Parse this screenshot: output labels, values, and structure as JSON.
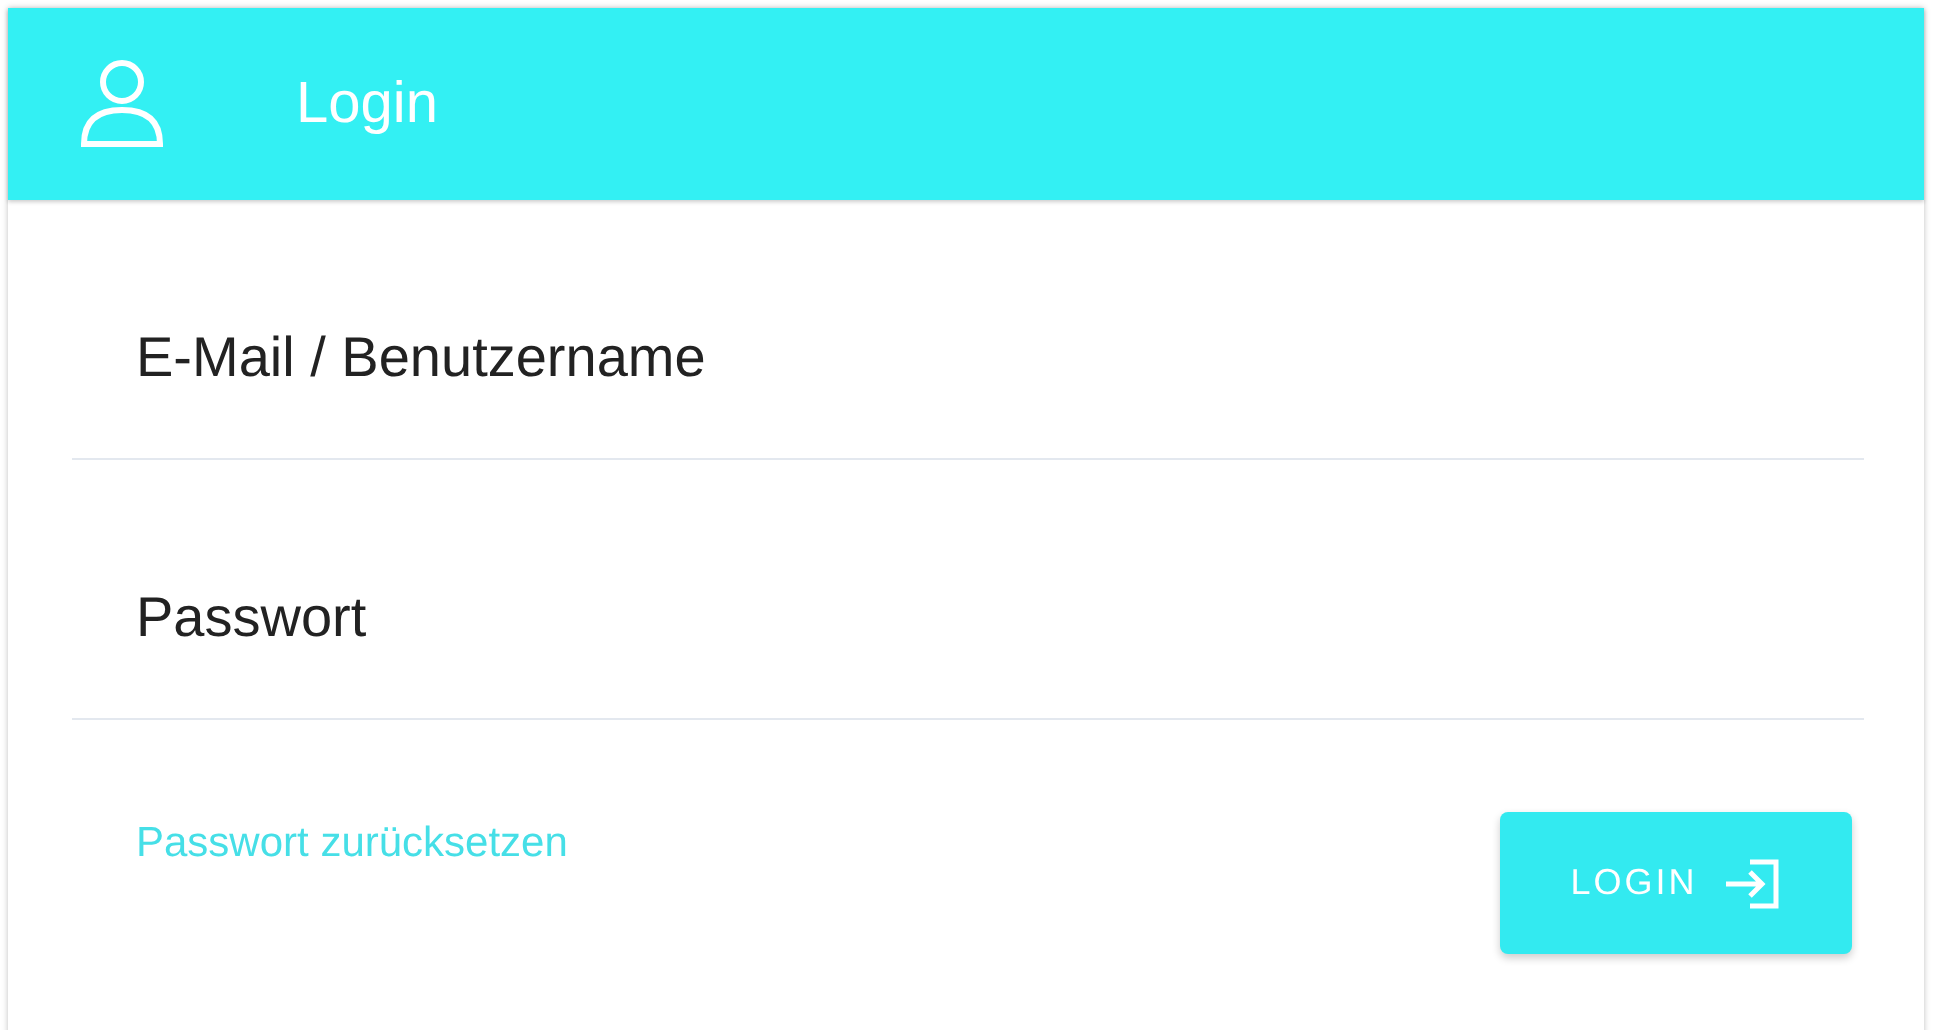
{
  "header": {
    "title": "Login"
  },
  "fields": [
    {
      "placeholder": "E-Mail / Benutzername"
    },
    {
      "placeholder": "Passwort"
    }
  ],
  "reset_link": "Passwort zurücksetzen",
  "login_button": "LOGIN"
}
